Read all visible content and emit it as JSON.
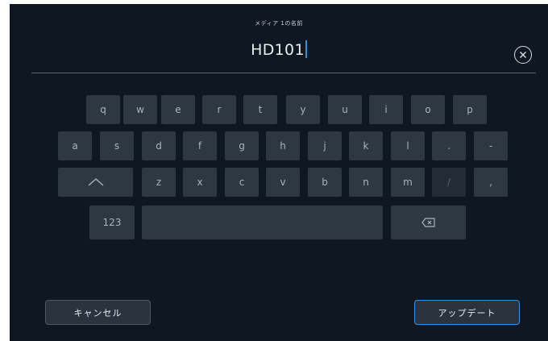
{
  "dialog": {
    "title": "メディア 1の名前",
    "name_value": "HD101"
  },
  "keyboard": {
    "row1": [
      "q",
      "w",
      "e",
      "r",
      "t",
      "y",
      "u",
      "i",
      "o",
      "p"
    ],
    "row2": [
      "a",
      "s",
      "d",
      "f",
      "g",
      "h",
      "j",
      "k",
      "l",
      ".",
      "-"
    ],
    "row3": [
      "z",
      "x",
      "c",
      "v",
      "b",
      "n",
      "m",
      "/",
      ","
    ],
    "numbers_label": "123"
  },
  "footer": {
    "cancel_label": "キャンセル",
    "update_label": "アップデート"
  },
  "icons": {
    "clear": "clear-circle-x-icon",
    "shift": "shift-caret-icon",
    "backspace": "backspace-icon"
  },
  "colors": {
    "background": "#0f1720",
    "key": "#2e3842",
    "accent": "#3b8fe0"
  }
}
